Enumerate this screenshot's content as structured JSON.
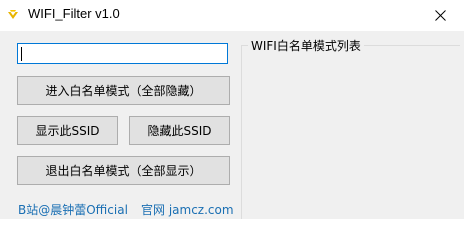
{
  "window": {
    "title": "WIFI_Filter v1.0"
  },
  "input": {
    "value": ""
  },
  "buttons": {
    "enter_whitelist": "进入白名单模式（全部隐藏）",
    "show_ssid": "显示此SSID",
    "hide_ssid": "隐藏此SSID",
    "exit_whitelist": "退出白名单模式（全部显示）"
  },
  "footer": {
    "bilibili": "B站@晨钟蕾Official",
    "website": "官网 jamcz.com"
  },
  "whitelist_panel": {
    "title": "WIFI白名单模式列表"
  },
  "icons": {
    "app": "app-icon",
    "close": "close-icon"
  },
  "colors": {
    "input_focus_border": "#0078d7",
    "link": "#1a6fb3",
    "button_face": "#e1e1e1",
    "client_bg": "#f0f0f0"
  }
}
